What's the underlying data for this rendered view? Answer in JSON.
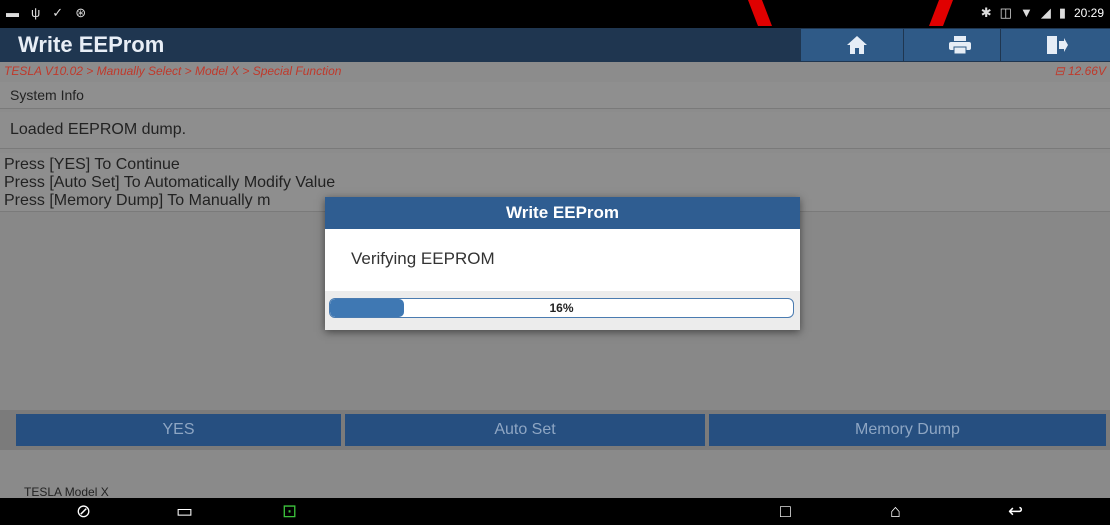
{
  "status_bar": {
    "time": "20:29",
    "left_icons": [
      "image-notification-icon",
      "usb-icon",
      "check-icon",
      "lock-icon"
    ],
    "right_icons": [
      "bluetooth-icon",
      "vibrate-icon",
      "wifi-icon",
      "signal-icon",
      "battery-icon"
    ]
  },
  "header": {
    "title": "Write EEProm",
    "buttons": [
      "home-icon",
      "print-icon",
      "exit-icon"
    ]
  },
  "breadcrumb": {
    "path": "TESLA V10.02 > Manually Select > Model X > Special Function",
    "voltage": "12.66V"
  },
  "system_info_label": "System Info",
  "messages": {
    "loaded": "Loaded EEPROM dump.",
    "instructions": [
      "Press [YES] To Continue",
      "Press [Auto Set] To Automatically Modify Value",
      "Press [Memory Dump] To Manually m"
    ]
  },
  "actions": {
    "yes": "YES",
    "auto_set": "Auto Set",
    "memory_dump": "Memory Dump"
  },
  "footer": {
    "vehicle": "TESLA Model X"
  },
  "dialog": {
    "title": "Write EEProm",
    "message": "Verifying EEPROM",
    "progress_text": "16%",
    "progress_fraction": 0.16
  },
  "colors": {
    "header_bg": "#1f3650",
    "button_bg": "#264f80",
    "breadcrumb_text": "#c0392b",
    "progress_fill": "#3f78b3"
  }
}
